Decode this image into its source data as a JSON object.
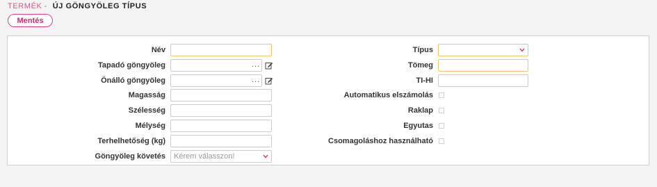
{
  "breadcrumb": {
    "parent": "TERMÉK",
    "separator": "-",
    "title": "ÚJ GÖNGYÖLEG TÍPUS"
  },
  "toolbar": {
    "save_label": "Mentés"
  },
  "form": {
    "left": {
      "nev": {
        "label": "Név",
        "value": ""
      },
      "tapado": {
        "label": "Tapadó göngyöleg",
        "value": "",
        "browse": "..."
      },
      "onallo": {
        "label": "Önálló göngyöleg",
        "value": "",
        "browse": "..."
      },
      "magassag": {
        "label": "Magasság",
        "value": ""
      },
      "szelesseg": {
        "label": "Szélesség",
        "value": ""
      },
      "melyseg": {
        "label": "Mélység",
        "value": ""
      },
      "terhelhetoseg": {
        "label": "Terhelhetőség (kg)",
        "value": ""
      },
      "kovetes": {
        "label": "Göngyöleg követés",
        "placeholder": "Kérem válasszon!"
      }
    },
    "right": {
      "tipus": {
        "label": "Típus",
        "value": ""
      },
      "tomeg": {
        "label": "Tömeg",
        "value": ""
      },
      "tihi": {
        "label": "TI-HI",
        "value": ""
      },
      "auto": {
        "label": "Automatikus elszámolás",
        "checked": false
      },
      "raklap": {
        "label": "Raklap",
        "checked": false
      },
      "egyutas": {
        "label": "Egyutas",
        "checked": false
      },
      "csomag": {
        "label": "Csomagoláshoz használható",
        "checked": false
      }
    }
  },
  "icons": {
    "edit": "edit-icon",
    "chevron": "chevron-down-icon"
  },
  "colors": {
    "accent": "#c52c78",
    "highlight_border": "#f3c56a"
  }
}
